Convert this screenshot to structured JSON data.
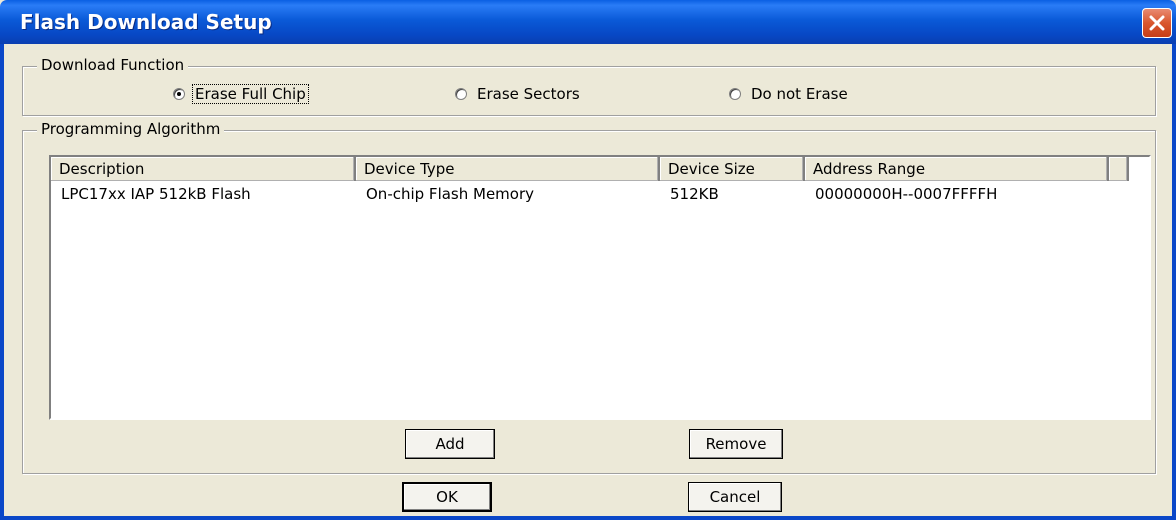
{
  "window": {
    "title": "Flash Download Setup"
  },
  "download_function": {
    "label": "Download Function",
    "options": [
      {
        "label": "Erase Full Chip",
        "selected": true
      },
      {
        "label": "Erase Sectors",
        "selected": false
      },
      {
        "label": "Do not Erase",
        "selected": false
      }
    ]
  },
  "programming_algorithm": {
    "label": "Programming Algorithm",
    "columns": [
      "Description",
      "Device Type",
      "Device Size",
      "Address Range"
    ],
    "rows": [
      [
        "LPC17xx IAP 512kB Flash",
        "On-chip Flash Memory",
        "512KB",
        "00000000H--0007FFFFH"
      ]
    ],
    "add_label": "Add",
    "remove_label": "Remove"
  },
  "buttons": {
    "ok": "OK",
    "cancel": "Cancel"
  },
  "icons": {
    "close": "close-icon"
  },
  "colors": {
    "titlebar": "#0a5ad8",
    "dialog_bg": "#ece9d8",
    "close_button": "#d9572e"
  }
}
